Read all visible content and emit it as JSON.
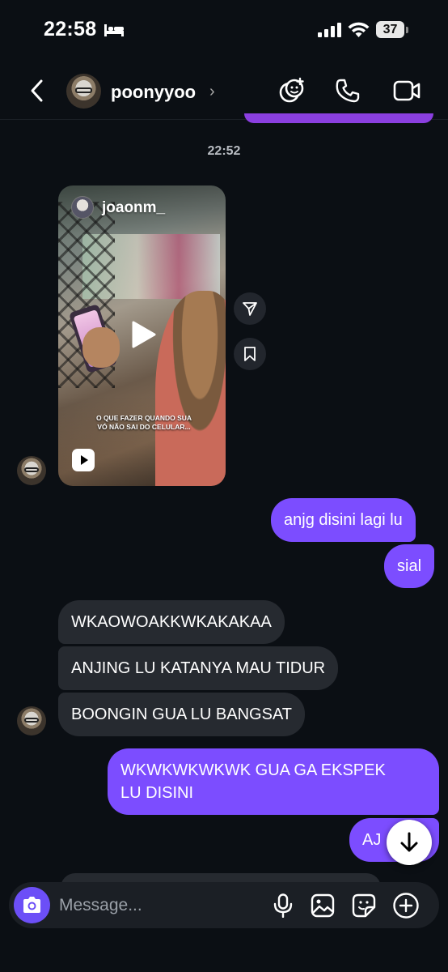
{
  "status_bar": {
    "time": "22:58",
    "battery": "37"
  },
  "header": {
    "username": "poonyyoo",
    "chevron": "›"
  },
  "chat": {
    "timestamp": "22:52",
    "reel": {
      "author": "joaonm_",
      "caption": "O QUE FAZER QUANDO SUA VÓ NÃO SAI DO CELULAR..."
    },
    "messages": [
      {
        "side": "out",
        "text": "anjg disini lagi lu"
      },
      {
        "side": "out",
        "text": "sial"
      },
      {
        "side": "in",
        "text": "WKAOWOAKKWKAKAKAA"
      },
      {
        "side": "in",
        "text": "ANJING LU KATANYA MAU TIDUR"
      },
      {
        "side": "in",
        "text": "BOONGIN GUA LU BANGSAT"
      },
      {
        "side": "out",
        "text": "WKWKWKWKWK GUA GA EKSPEK"
      },
      {
        "side": "out",
        "text": "LU DISINI"
      },
      {
        "side": "out",
        "text": "AJ"
      }
    ]
  },
  "composer": {
    "placeholder": "Message..."
  },
  "colors": {
    "background": "#0b0f14",
    "outgoing_bubble": "#7c4dff",
    "incoming_bubble": "#262a30",
    "camera_button": "#6c4ff7"
  },
  "icons": [
    "back-icon",
    "effects-icon",
    "phone-icon",
    "video-icon",
    "play-icon",
    "reel-icon",
    "share-icon",
    "bookmark-icon",
    "arrow-down-icon",
    "camera-icon",
    "mic-icon",
    "gallery-icon",
    "sticker-icon",
    "plus-icon"
  ]
}
